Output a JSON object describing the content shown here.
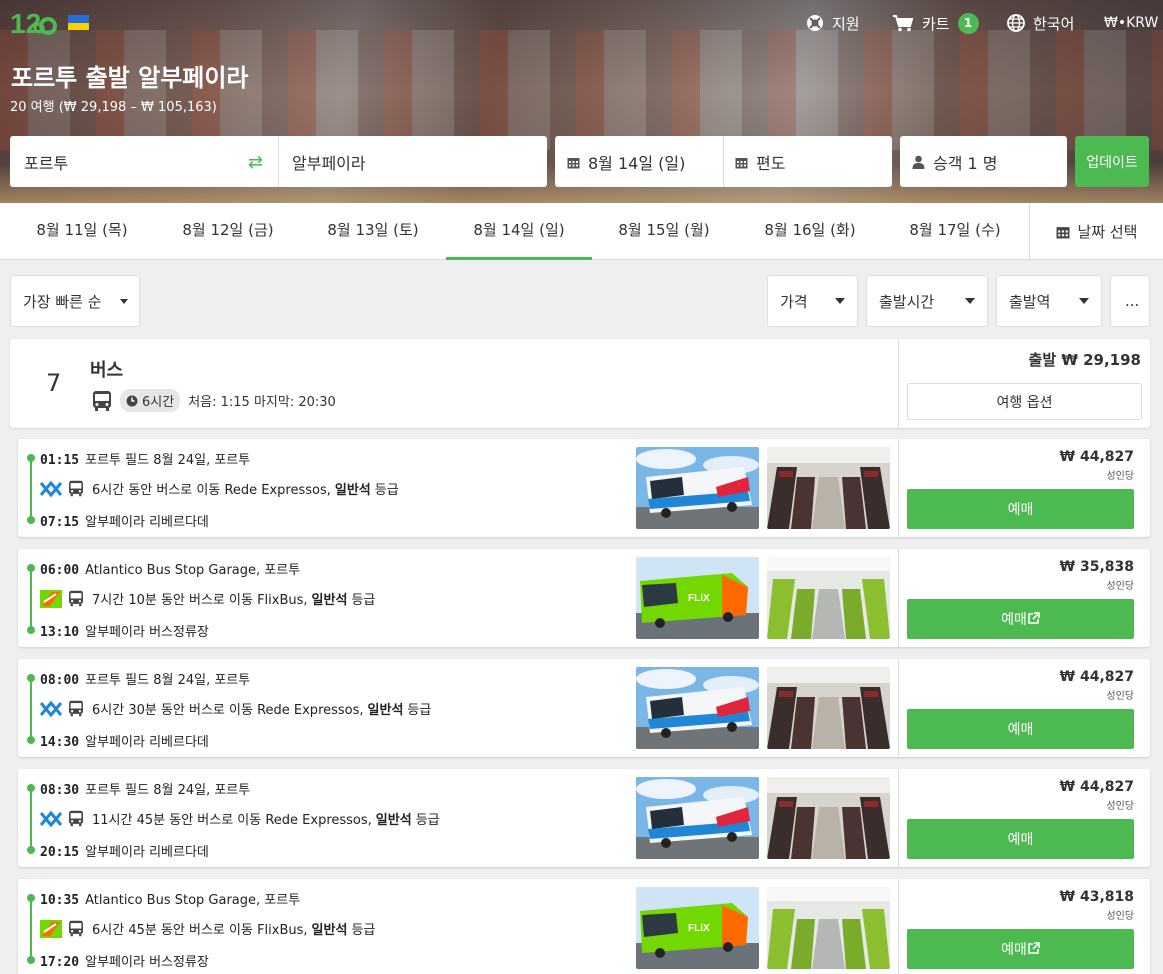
{
  "header": {
    "support_label": "지원",
    "cart_label": "카트",
    "cart_count": "1",
    "language_label": "한국어",
    "currency_label": "₩•KRW",
    "route_title": "포르투 출발 알부페이라",
    "route_subtitle": "20 여행 (₩ 29,198 – ₩ 105,163)"
  },
  "search": {
    "from": "포르투",
    "to": "알부페이라",
    "date": "8월 14일 (일)",
    "return": "편도",
    "passengers": "승객 1 명",
    "update_label": "업데이트"
  },
  "dates": {
    "tabs": [
      "8월 11일 (목)",
      "8월 12일 (금)",
      "8월 13일 (토)",
      "8월 14일 (일)",
      "8월 15일 (월)",
      "8월 16일 (화)",
      "8월 17일 (수)"
    ],
    "active_index": 3,
    "picker_label": "날짜 선택"
  },
  "filters": {
    "sort_label": "가장 빠른 순",
    "price_label": "가격",
    "departure_time_label": "출발시간",
    "departure_station_label": "출발역",
    "more_label": "..."
  },
  "summary": {
    "count": "7",
    "type_label": "버스",
    "duration": "6시간",
    "first_last": "처음: 1:15 마지막: 20:30",
    "from_price": "출발 ₩ 29,198",
    "options_label": "여행 옵션"
  },
  "trips": [
    {
      "dep_time": "01:15",
      "dep_place": "포르투 필드 8월 24일, 포르투",
      "desc": "6시간 동안 버스로 이동 Rede Expressos,",
      "class": "일반석",
      "class_suffix": "등급",
      "arr_time": "07:15",
      "arr_place": "알부페이라 리베르다데",
      "price": "₩ 44,827",
      "per": "성인당",
      "book_label": "예매",
      "operator_icon": "rede-expressos-logo",
      "external": false
    },
    {
      "dep_time": "06:00",
      "dep_place": "Atlantico Bus Stop Garage, 포르투",
      "desc": "7시간 10분 동안 버스로 이동 FlixBus,",
      "class": "일반석",
      "class_suffix": "등급",
      "arr_time": "13:10",
      "arr_place": "알부페이라 버스정류장",
      "price": "₩ 35,838",
      "per": "성인당",
      "book_label": "예매",
      "operator_icon": "flixbus-logo",
      "external": true
    },
    {
      "dep_time": "08:00",
      "dep_place": "포르투 필드 8월 24일, 포르투",
      "desc": "6시간 30분 동안 버스로 이동 Rede Expressos,",
      "class": "일반석",
      "class_suffix": "등급",
      "arr_time": "14:30",
      "arr_place": "알부페이라 리베르다데",
      "price": "₩ 44,827",
      "per": "성인당",
      "book_label": "예매",
      "operator_icon": "rede-expressos-logo",
      "external": false
    },
    {
      "dep_time": "08:30",
      "dep_place": "포르투 필드 8월 24일, 포르투",
      "desc": "11시간 45분 동안 버스로 이동 Rede Expressos,",
      "class": "일반석",
      "class_suffix": "등급",
      "arr_time": "20:15",
      "arr_place": "알부페이라 리베르다데",
      "price": "₩ 44,827",
      "per": "성인당",
      "book_label": "예매",
      "operator_icon": "rede-expressos-logo",
      "external": false
    },
    {
      "dep_time": "10:35",
      "dep_place": "Atlantico Bus Stop Garage, 포르투",
      "desc": "6시간 45분 동안 버스로 이동 FlixBus,",
      "class": "일반석",
      "class_suffix": "등급",
      "arr_time": "17:20",
      "arr_place": "알부페이라 버스정류장",
      "price": "₩ 43,818",
      "per": "성인당",
      "book_label": "예매",
      "operator_icon": "flixbus-logo",
      "external": true
    }
  ],
  "colors": {
    "accent": "#4cba50",
    "rede_blue": "#1f86d8",
    "flix_green": "#73d700",
    "flix_orange": "#ff6a00"
  }
}
